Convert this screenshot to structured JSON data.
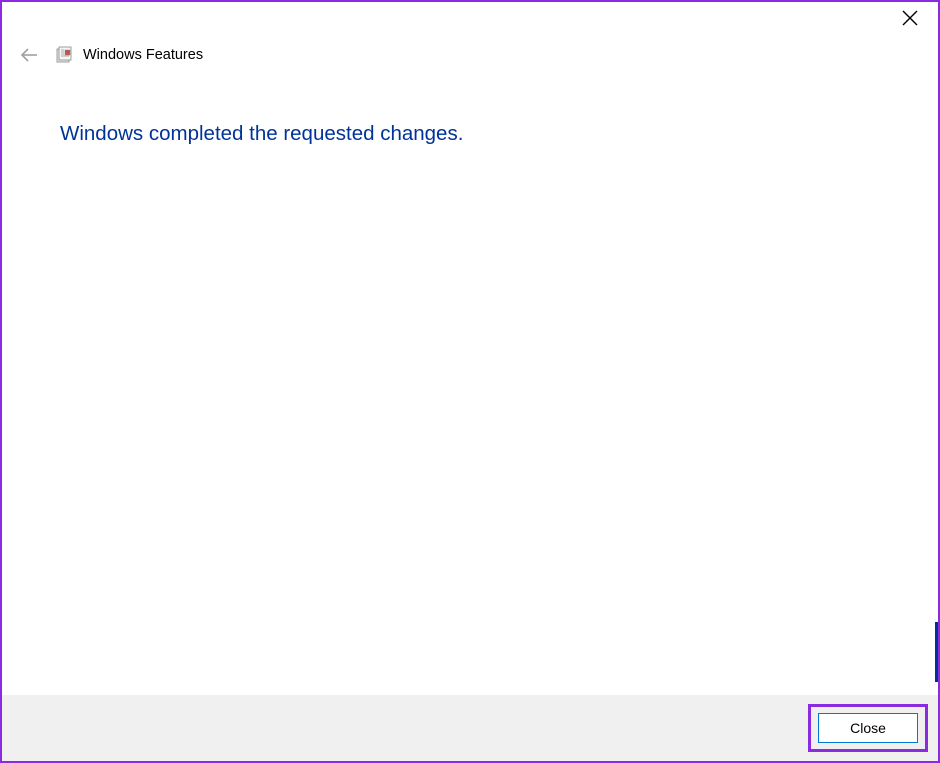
{
  "titlebar": {
    "close_icon": "close"
  },
  "header": {
    "back_icon": "back-arrow",
    "app_icon": "windows-features",
    "title": "Windows Features"
  },
  "content": {
    "heading": "Windows completed the requested changes."
  },
  "footer": {
    "close_label": "Close"
  }
}
